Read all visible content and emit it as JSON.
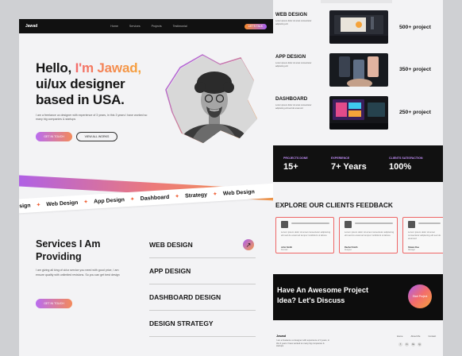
{
  "nav": {
    "logo": "Jawad",
    "links": [
      "Home",
      "Services",
      "Projects",
      "Testimonial"
    ],
    "cta": "LET'S TALK"
  },
  "hero": {
    "line1_a": "Hello, ",
    "line1_b": "I'm Jawad,",
    "line2": "ui/ux designer",
    "line3": "based in USA.",
    "description": "I am a freelance ux designer with experience of 3 years, in this 3 years I have worked so many big companies & startups",
    "btn_primary": "GET IN TOUCH",
    "btn_secondary": "VIEW ALL WORKS"
  },
  "ribbon": {
    "items": [
      "esign",
      "Web Design",
      "App Design",
      "Dashboard",
      "Strategy",
      "Web Design"
    ]
  },
  "services": {
    "title_l1": "Services I Am",
    "title_l2": "Providing",
    "description": "I am giving all king of ui/ux service you need with good price, I am ensure quality with unlimited revisions. So you can get best design",
    "btn": "GET IN TOUCH",
    "items": [
      "WEB DESIGN",
      "APP DESIGN",
      "DASHBOARD DESIGN",
      "DESIGN STRATEGY"
    ]
  },
  "projects": [
    {
      "title": "WEB DESIGN",
      "desc": "Lorem ipsum dolor sit amet consectetur adipiscing elit",
      "count": "500+ project"
    },
    {
      "title": "APP DESIGN",
      "desc": "Lorem ipsum dolor sit amet consectetur adipiscing elit",
      "count": "350+ project"
    },
    {
      "title": "DASHBOARD",
      "desc": "Lorem ipsum dolor sit amet consectetur adipiscing elit sed do eiusmod",
      "count": "250+ project"
    }
  ],
  "stats": [
    {
      "label": "PROJECTS DONE",
      "value": "15+"
    },
    {
      "label": "EXPERIENCE",
      "value": "7+ Years"
    },
    {
      "label": "CLIENTS SATISFACTION",
      "value": "100%"
    }
  ],
  "feedback": {
    "title": "EXPLORE OUR CLIENTS FEEDBACK",
    "cards": [
      {
        "text": "Lorem ipsum dolor sit amet consectetur adipiscing elit sed do eiusmod tempor incididunt ut labore",
        "name": "John Smith",
        "role": "Founder"
      },
      {
        "text": "Lorem ipsum dolor sit amet consectetur adipiscing elit sed do eiusmod tempor incididunt ut labore",
        "name": "Rachel Smith",
        "role": "Designer"
      },
      {
        "text": "Lorem ipsum dolor sit amet consectetur adipiscing elit sed do eiusmod",
        "name": "Shawn Doe",
        "role": "Manager"
      }
    ]
  },
  "cta": {
    "line1": "Have An Awesome Project",
    "line2": "Idea? Let's Discuss",
    "btn": "Start Project"
  },
  "footer": {
    "logo": "Jawad",
    "desc": "I am a freelance ux designer with experience of 3 years, in this 3 years I have worked so many big companies & startups",
    "links": [
      "Home",
      "About Me",
      "Contact"
    ],
    "social": [
      "f",
      "in",
      "tw",
      "ig"
    ]
  },
  "colors": {
    "accent_orange": "#f5a33a",
    "accent_purple": "#a95ef1",
    "accent_coral": "#f36c6c",
    "dark": "#111111"
  }
}
